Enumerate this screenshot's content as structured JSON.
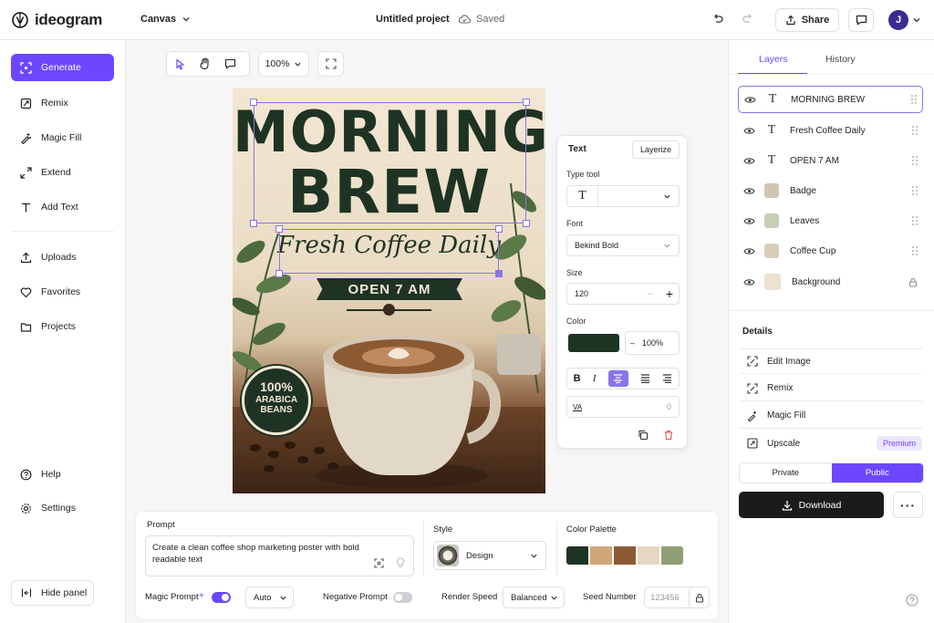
{
  "app": {
    "logo_text": "ideogram"
  },
  "topbar": {
    "canvas_menu": "Canvas",
    "project_title": "Untitled project",
    "save_status": "Saved",
    "share_label": "Share",
    "avatar_initial": "J"
  },
  "sidebar": {
    "items": [
      {
        "label": "Generate",
        "icon": "generate-icon",
        "active": true
      },
      {
        "label": "Remix",
        "icon": "remix-icon"
      },
      {
        "label": "Magic Fill",
        "icon": "magic-fill-icon"
      },
      {
        "label": "Extend",
        "icon": "extend-icon"
      },
      {
        "label": "Add Text",
        "icon": "text-icon"
      },
      {
        "label": "Uploads",
        "icon": "upload-icon"
      },
      {
        "label": "Favorites",
        "icon": "heart-icon"
      },
      {
        "label": "Projects",
        "icon": "folder-icon"
      },
      {
        "label": "Help",
        "icon": "help-icon"
      },
      {
        "label": "Settings",
        "icon": "gear-icon"
      }
    ],
    "hide_panel": "Hide panel"
  },
  "canvas": {
    "zoom": "100%"
  },
  "poster": {
    "line1": "MORNING",
    "line2": "BREW",
    "script_line": "Fresh Coffee Daily",
    "banner": "OPEN 7 AM",
    "badge_percent": "100%",
    "badge_line1": "ARABICA",
    "badge_line2": "BEANS"
  },
  "text_panel": {
    "title": "Text",
    "layerize": "Layerize",
    "type_tool_label": "Type tool",
    "type_tool_glyph": "T",
    "font_label": "Font",
    "font_value": "Bekind Bold",
    "size_label": "Size",
    "size_value": "120",
    "color_label": "Color",
    "color_value": "#1f3325",
    "opacity": "100%",
    "spacing_value": "0",
    "spacing_glyph": "VA"
  },
  "right_panel": {
    "tabs": [
      "Layers",
      "History"
    ],
    "active_tab": "Layers",
    "layers": [
      {
        "label": "MORNING BREW",
        "kind": "text",
        "selected": true
      },
      {
        "label": "Fresh Coffee Daily",
        "kind": "text"
      },
      {
        "label": "OPEN 7 AM",
        "kind": "text"
      },
      {
        "label": "Badge",
        "kind": "image"
      },
      {
        "label": "Leaves",
        "kind": "image"
      },
      {
        "label": "Coffee Cup",
        "kind": "image"
      },
      {
        "label": "Background",
        "kind": "image",
        "locked": true
      }
    ],
    "details_title": "Details",
    "details": [
      {
        "label": "Edit Image",
        "icon": "edit-image-icon"
      },
      {
        "label": "Remix",
        "icon": "remix-icon"
      },
      {
        "label": "Magic Fill",
        "icon": "magic-fill-icon"
      },
      {
        "label": "Upscale",
        "icon": "upscale-icon",
        "badge": "Premium"
      }
    ],
    "visibility": [
      "Private",
      "Public"
    ],
    "active_visibility": "Public",
    "download": "Download"
  },
  "prompt_bar": {
    "prompt_label": "Prompt",
    "prompt_text": "Create a clean coffee shop marketing poster with bold readable text",
    "style_label": "Style",
    "style_value": "Design",
    "palette_label": "Color Palette",
    "palette": [
      "#1f3325",
      "#d1a67a",
      "#8b5a35",
      "#e6d7c2",
      "#8f9e75"
    ],
    "magic_prompt_label": "Magic Prompt",
    "magic_prompt_on": true,
    "magic_prompt_mode": "Auto",
    "negative_prompt_label": "Negative Prompt",
    "negative_prompt_on": false,
    "render_speed_label": "Render Speed",
    "render_speed_value": "Balanced",
    "seed_label": "Seed Number",
    "seed_value": "123456"
  },
  "colors": {
    "accent": "#6c47ff",
    "dark_green": "#1f3325",
    "download_bg": "#1b1b1d"
  }
}
